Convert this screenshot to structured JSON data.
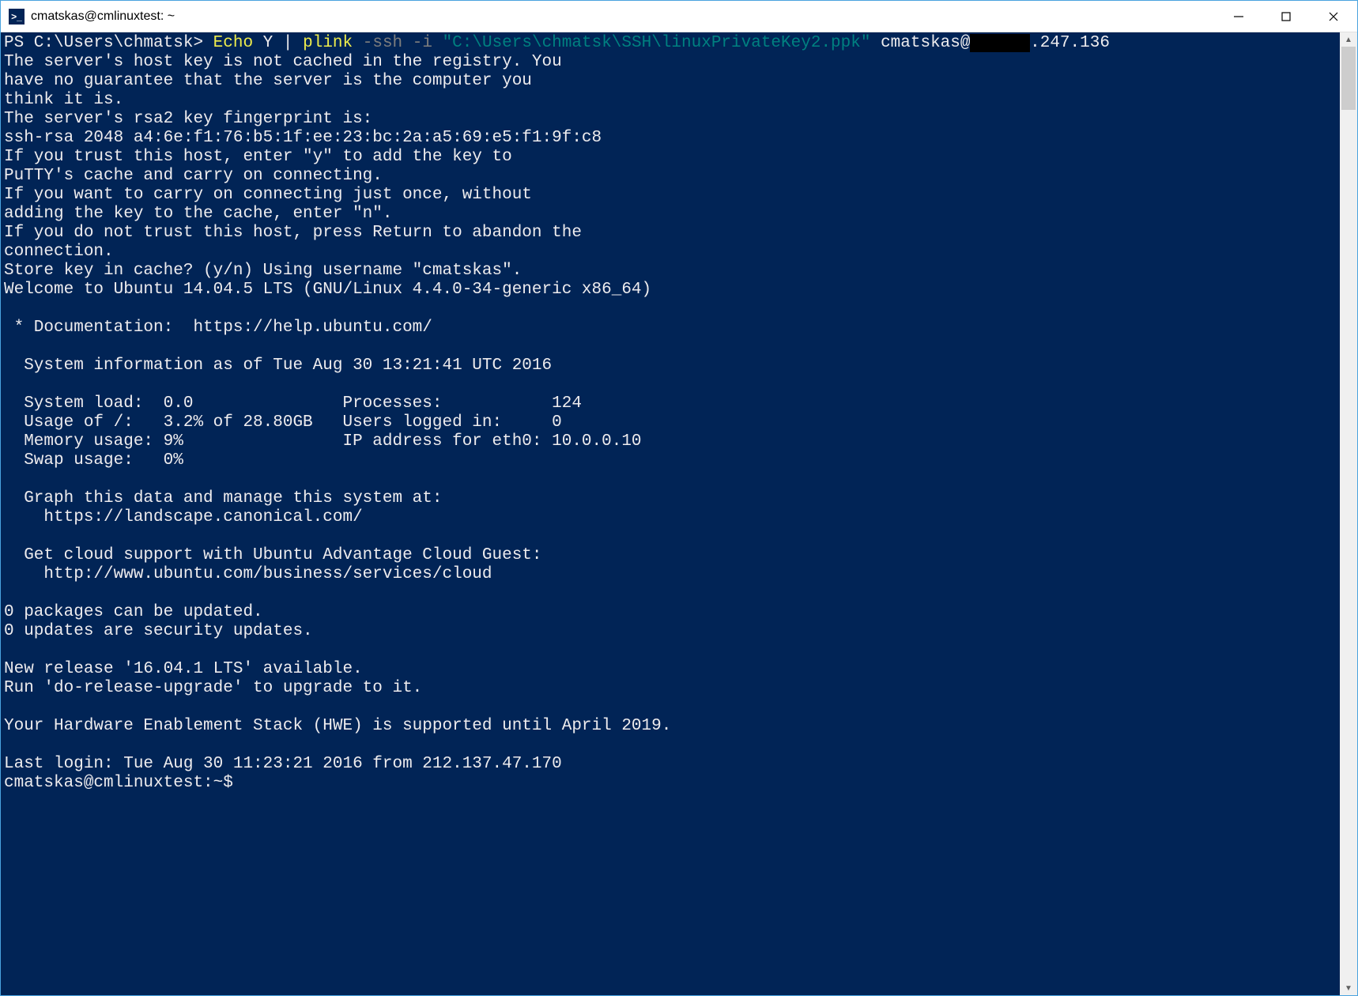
{
  "window": {
    "title": "cmatskas@cmlinuxtest: ~",
    "icon_glyph": ">_"
  },
  "prompt": {
    "ps_prefix": "PS C:\\Users\\chmatsk> ",
    "cmd_echo": "Echo ",
    "cmd_y": "Y ",
    "cmd_pipe": "| ",
    "cmd_plink": "plink ",
    "cmd_flags": "-ssh -i ",
    "cmd_keypath": "\"C:\\Users\\chmatsk\\SSH\\linuxPrivateKey2.ppk\" ",
    "cmd_userhost": "cmatskas@",
    "cmd_redacted": "XXXXXX",
    "cmd_ip_tail": ".247.136"
  },
  "output": {
    "l01": "The server's host key is not cached in the registry. You",
    "l02": "have no guarantee that the server is the computer you",
    "l03": "think it is.",
    "l04": "The server's rsa2 key fingerprint is:",
    "l05": "ssh-rsa 2048 a4:6e:f1:76:b5:1f:ee:23:bc:2a:a5:69:e5:f1:9f:c8",
    "l06": "If you trust this host, enter \"y\" to add the key to",
    "l07": "PuTTY's cache and carry on connecting.",
    "l08": "If you want to carry on connecting just once, without",
    "l09": "adding the key to the cache, enter \"n\".",
    "l10": "If you do not trust this host, press Return to abandon the",
    "l11": "connection.",
    "l12": "Store key in cache? (y/n) Using username \"cmatskas\".",
    "l13": "Welcome to Ubuntu 14.04.5 LTS (GNU/Linux 4.4.0-34-generic x86_64)",
    "l14": "",
    "l15": " * Documentation:  https://help.ubuntu.com/",
    "l16": "",
    "l17": "  System information as of Tue Aug 30 13:21:41 UTC 2016",
    "l18": "",
    "l19": "  System load:  0.0               Processes:           124",
    "l20": "  Usage of /:   3.2% of 28.80GB   Users logged in:     0",
    "l21": "  Memory usage: 9%                IP address for eth0: 10.0.0.10",
    "l22": "  Swap usage:   0%",
    "l23": "",
    "l24": "  Graph this data and manage this system at:",
    "l25": "    https://landscape.canonical.com/",
    "l26": "",
    "l27": "  Get cloud support with Ubuntu Advantage Cloud Guest:",
    "l28": "    http://www.ubuntu.com/business/services/cloud",
    "l29": "",
    "l30": "0 packages can be updated.",
    "l31": "0 updates are security updates.",
    "l32": "",
    "l33": "New release '16.04.1 LTS' available.",
    "l34": "Run 'do-release-upgrade' to upgrade to it.",
    "l35": "",
    "l36": "Your Hardware Enablement Stack (HWE) is supported until April 2019.",
    "l37": "",
    "l38": "Last login: Tue Aug 30 11:23:21 2016 from 212.137.47.170",
    "l39": "cmatskas@cmlinuxtest:~$"
  }
}
